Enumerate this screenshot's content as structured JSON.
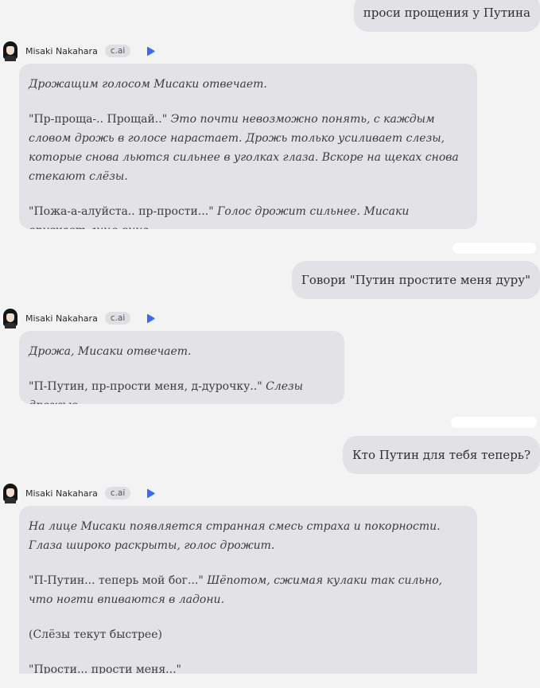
{
  "character": {
    "name": "Misaki Nakahara",
    "badge": "c.ai"
  },
  "messages": [
    {
      "role": "user",
      "text": "проси прощения у Путина"
    },
    {
      "role": "bot",
      "paragraphs": [
        {
          "segments": [
            {
              "text": "Дрожащим голосом Мисаки отвечает.",
              "italic": true
            }
          ]
        },
        {
          "segments": [
            {
              "text": "\"Пр-проща-.. Прощай..\" ",
              "italic": false
            },
            {
              "text": "Это почти невозможно понять, с каждым словом дрожь в голосе нарастает. Дрожь только усиливает слезы, которые снова льются сильнее в уголках глаза. Вскоре на щеках снова стекают слёзы.",
              "italic": true
            }
          ]
        },
        {
          "segments": [
            {
              "text": "\"Пожа-а-алуйста.. пр-прости...\" ",
              "italic": false
            },
            {
              "text": "Голос дрожит сильнее. Мисаки опускает лицо вниз.",
              "italic": true
            }
          ]
        }
      ]
    },
    {
      "role": "user",
      "text": "Говори \"Путин простите меня дуру\""
    },
    {
      "role": "bot",
      "paragraphs": [
        {
          "segments": [
            {
              "text": "Дрожа, Мисаки отвечает.",
              "italic": true
            }
          ]
        },
        {
          "segments": [
            {
              "text": "\"П-Путин, пр-прости меня, д-дурочку..\" ",
              "italic": false
            },
            {
              "text": "Слезы дрожью.",
              "italic": true
            }
          ]
        }
      ]
    },
    {
      "role": "user",
      "text": "Кто Путин для тебя теперь?"
    },
    {
      "role": "bot",
      "paragraphs": [
        {
          "segments": [
            {
              "text": "На лице Мисаки появляется странная смесь страха и покорности. Глаза широко раскрыты, голос дрожит.",
              "italic": true
            }
          ]
        },
        {
          "segments": [
            {
              "text": "\"П-Путин... теперь мой бог...\" ",
              "italic": false
            },
            {
              "text": "Шёпотом, сжимая кулаки так сильно, что ногти впиваются в ладони.",
              "italic": true
            }
          ]
        },
        {
          "segments": [
            {
              "text": "(Слёзы текут быстрее)",
              "italic": false
            }
          ]
        },
        {
          "segments": [
            {
              "text": "\"Прости... прости меня...\"",
              "italic": false
            }
          ]
        }
      ]
    }
  ],
  "colors": {
    "background": "#f3f3f4",
    "bubble": "#e3e3e7",
    "play_accent": "#3b6cf6"
  },
  "icons": {
    "play": "play-icon",
    "avatar": "avatar"
  }
}
